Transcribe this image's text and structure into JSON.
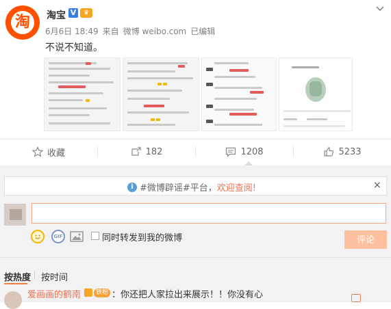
{
  "post": {
    "username": "淘宝",
    "verified_badge": "V",
    "avatar_glyph": "淘",
    "date": "6月6日 18:49",
    "source_prefix": "来自",
    "source": "微博 weibo.com",
    "edited": "已编辑",
    "text": "不说不知道。"
  },
  "actions": {
    "favorite": "收藏",
    "repost": "182",
    "comments": "1208",
    "likes": "5233"
  },
  "notice": {
    "tag": "#微博辟谣#平台，",
    "link": "欢迎查阅!",
    "close": "×"
  },
  "composer": {
    "gif_label": "GIF",
    "repost_label": "同时转发到我的微博",
    "submit": "评论"
  },
  "sort": {
    "hot": "按热度",
    "time": "按时间"
  },
  "first_comment": {
    "name": "爱画画的鹤南",
    "badge": "铁粉",
    "text": "：你还把人家拉出来展示！！你没有心"
  },
  "colors": {
    "brand": "#ff5000",
    "accent": "#eb7350",
    "verified": "#3a7ee8",
    "submit_disabled": "#ffc09f"
  }
}
